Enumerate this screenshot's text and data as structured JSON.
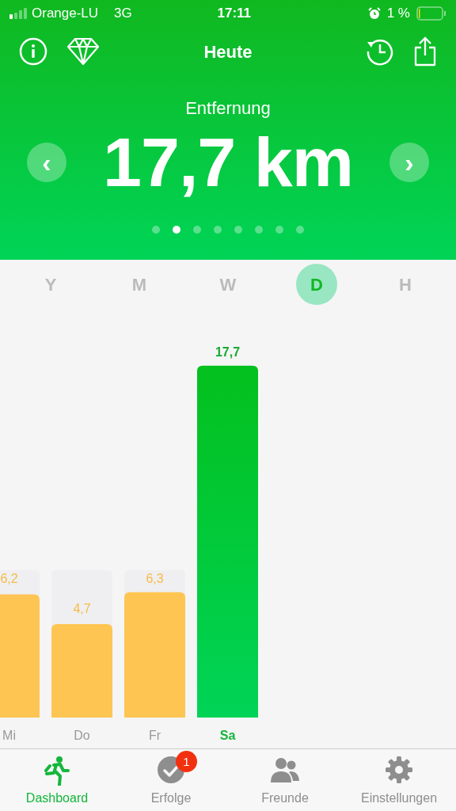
{
  "status_bar": {
    "carrier": "Orange-LU",
    "network": "3G",
    "time": "17:11",
    "battery_percent": "1 %"
  },
  "nav_bar": {
    "title": "Heute"
  },
  "metric": {
    "label": "Entfernung",
    "value": "17,7 km",
    "prev_button": "‹",
    "next_button": "›"
  },
  "page_dots": [
    {
      "selected": false
    },
    {
      "selected": true
    },
    {
      "selected": false
    },
    {
      "selected": false
    },
    {
      "selected": false
    },
    {
      "selected": false
    },
    {
      "selected": false
    },
    {
      "selected": false
    }
  ],
  "periods": [
    {
      "label": "Y",
      "selected": false
    },
    {
      "label": "M",
      "selected": false
    },
    {
      "label": "W",
      "selected": false
    },
    {
      "label": "D",
      "selected": true
    },
    {
      "label": "H",
      "selected": false
    }
  ],
  "chart": {
    "bars": [
      {
        "selected": false
      },
      {
        "selected": false
      },
      {
        "selected": false
      },
      {
        "selected": true
      }
    ],
    "chart_data": {
      "type": "bar",
      "categories": [
        "Mi",
        "Do",
        "Fr",
        "Sa"
      ],
      "values": [
        6.2,
        4.7,
        6.3,
        17.7
      ],
      "value_labels": [
        "6,2",
        "4,7",
        "6,3",
        "17,7"
      ],
      "data_labels": true
    }
  },
  "tab_bar": [
    {
      "label": "Dashboard",
      "selected": true,
      "kind": "runner"
    },
    {
      "label": "Erfolge",
      "selected": false,
      "kind": "check",
      "badge": "1"
    },
    {
      "label": "Freunde",
      "selected": false,
      "kind": "people"
    },
    {
      "label": "Einstellungen",
      "selected": false,
      "kind": "gear"
    }
  ]
}
